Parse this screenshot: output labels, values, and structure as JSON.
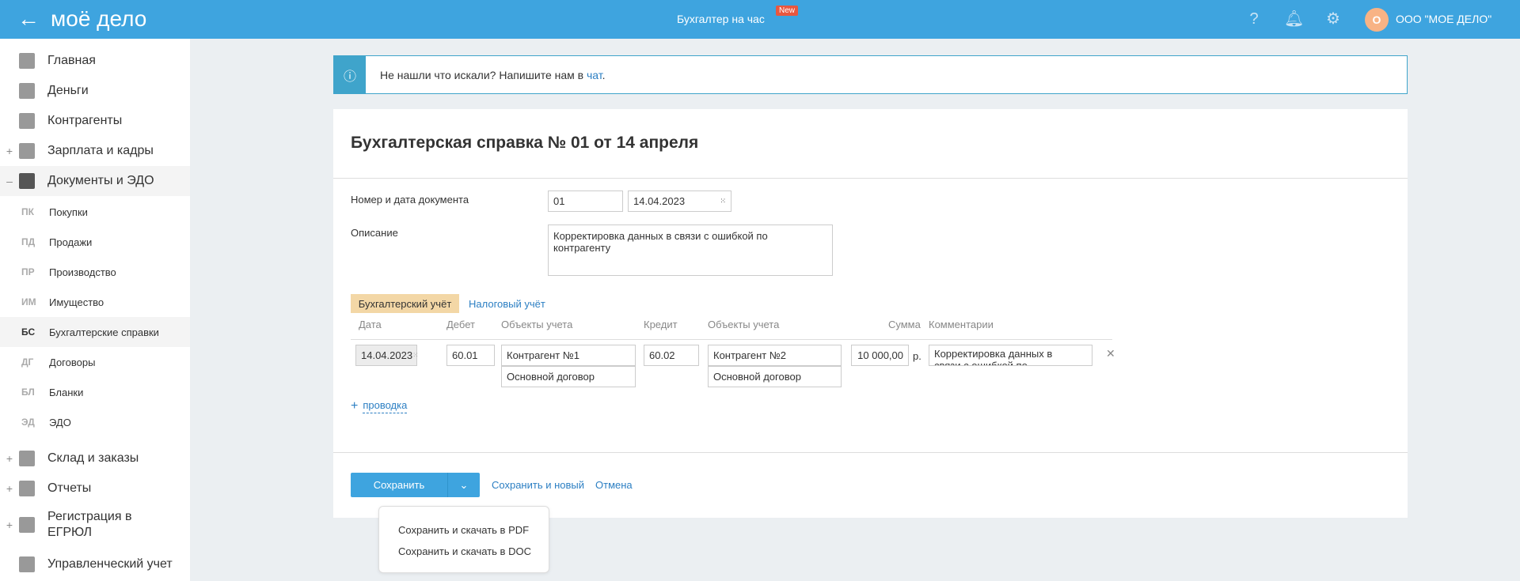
{
  "header": {
    "logo": "моё дело",
    "center": "Бухгалтер на час",
    "badge": "New",
    "avatar": "О",
    "org": "ООО \"МОЕ ДЕЛО\""
  },
  "sidebar": {
    "items": [
      {
        "label": "Главная"
      },
      {
        "label": "Деньги"
      },
      {
        "label": "Контрагенты"
      },
      {
        "label": "Зарплата и кадры",
        "pm": "+"
      },
      {
        "label": "Документы и ЭДО",
        "pm": "–"
      }
    ],
    "sub": [
      {
        "ab": "ПК",
        "label": "Покупки"
      },
      {
        "ab": "ПД",
        "label": "Продажи"
      },
      {
        "ab": "ПР",
        "label": "Производство"
      },
      {
        "ab": "ИМ",
        "label": "Имущество"
      },
      {
        "ab": "БС",
        "label": "Бухгалтерские справки"
      },
      {
        "ab": "ДГ",
        "label": "Договоры"
      },
      {
        "ab": "БЛ",
        "label": "Бланки"
      },
      {
        "ab": "ЭД",
        "label": "ЭДО"
      }
    ],
    "bottom": [
      {
        "label": "Склад и заказы",
        "pm": "+"
      },
      {
        "label": "Отчеты",
        "pm": "+"
      },
      {
        "label": "Регистрация в ЕГРЮЛ",
        "pm": "+"
      },
      {
        "label": "Управленческий учет"
      }
    ]
  },
  "info": {
    "text": "Не нашли что искали? Напишите нам в ",
    "link": "чат",
    "dot": "."
  },
  "form": {
    "title": "Бухгалтерская справка № 01 от 14 апреля",
    "num_label": "Номер и дата документа",
    "num": "01",
    "date": "14.04.2023",
    "desc_label": "Описание",
    "desc": "Корректировка данных в связи с ошибкой по контрагенту"
  },
  "tabs": [
    "Бухгалтерский учёт",
    "Налоговый учёт"
  ],
  "table": {
    "headers": [
      "Дата",
      "Дебет",
      "Объекты учета",
      "Кредит",
      "Объекты учета",
      "Сумма",
      "Комментарии"
    ],
    "row": {
      "date": "14.04.2023",
      "debit": "60.01",
      "debit_obj1": "Контрагент №1",
      "debit_obj2": "Основной договор",
      "credit": "60.02",
      "credit_obj1": "Контрагент №2",
      "credit_obj2": "Основной договор",
      "sum": "10 000,00",
      "currency": "р.",
      "comment": "Корректировка данных в связи с ошибкой по контрагенту"
    }
  },
  "add_entry": "проводка",
  "footer": {
    "save": "Сохранить",
    "save_new": "Сохранить и новый",
    "cancel": "Отмена",
    "menu": [
      "Сохранить и скачать в PDF",
      "Сохранить и скачать в DOC"
    ]
  }
}
